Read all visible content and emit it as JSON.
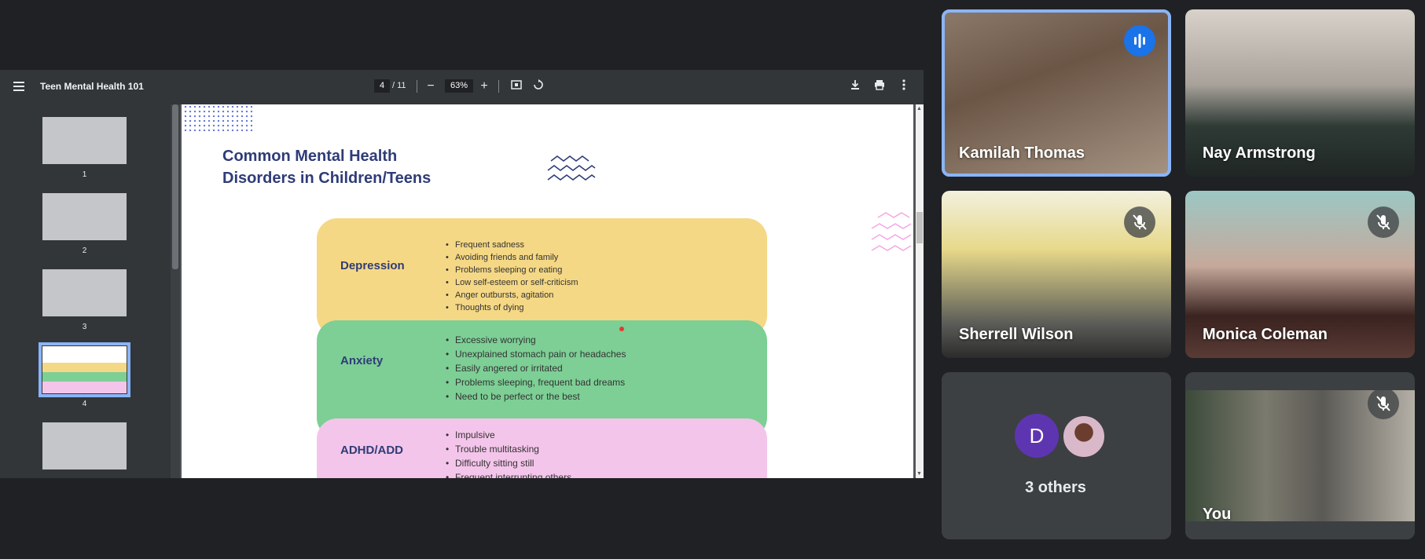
{
  "pdf": {
    "title": "Teen Mental Health 101",
    "page_current": "4",
    "page_total": "/ 11",
    "zoom": "63%",
    "thumbnails": [
      "1",
      "2",
      "3",
      "4"
    ],
    "slide": {
      "title": "Common Mental Health Disorders in Children/Teens",
      "sections": [
        {
          "name": "Depression",
          "color": "#f5d885",
          "items": [
            "Frequent sadness",
            "Avoiding friends and family",
            "Problems sleeping or eating",
            "Low self-esteem or self-criticism",
            "Anger outbursts, agitation",
            "Thoughts of dying"
          ]
        },
        {
          "name": "Anxiety",
          "color": "#7dcf95",
          "items": [
            "Excessive worrying",
            "Unexplained stomach pain or headaches",
            "Easily angered or irritated",
            "Problems sleeping, frequent bad dreams",
            "Need to be perfect or the best"
          ]
        },
        {
          "name": "ADHD/ADD",
          "color": "#f4c5ea",
          "items": [
            "Impulsive",
            "Trouble multitasking",
            "Difficulty sitting still",
            "Frequent interrupting others"
          ]
        }
      ]
    }
  },
  "participants": {
    "kamilah": "Kamilah Thomas",
    "nay": "Nay Armstrong",
    "sherrell": "Sherrell Wilson",
    "monica": "Monica Coleman",
    "others_initial": "D",
    "others_label": "3 others",
    "you": "You"
  },
  "colors": {
    "speaking_outline": "#8ab4f8",
    "speaking_indicator": "#1a73e8"
  }
}
